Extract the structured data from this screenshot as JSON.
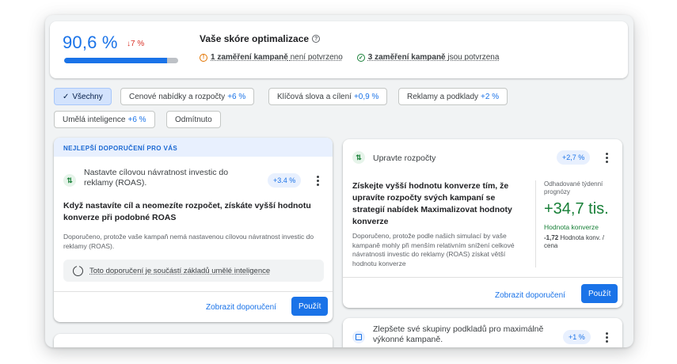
{
  "score": {
    "value": "90,6 %",
    "delta": "↓7 %",
    "progress_percent": 90.6,
    "title": "Vaše skóre optimalizace",
    "status_unconfirmed_count": "1 zaměření kampaně",
    "status_unconfirmed_suffix": "není potvrzeno",
    "status_confirmed_count": "3 zaměření kampaně",
    "status_confirmed_suffix": "jsou potvrzena"
  },
  "filters": {
    "all": "Všechny",
    "bids": "Cenové nabídky a rozpočty",
    "bids_delta": "+6 %",
    "keywords": "Klíčová slova a cílení",
    "keywords_delta": "+0,9 %",
    "ads": "Reklamy a podklady",
    "ads_delta": "+2 %",
    "ai": "Umělá inteligence",
    "ai_delta": "+6 %",
    "dismissed": "Odmítnuto"
  },
  "card_roas": {
    "header": "NEJLEPŠÍ DOPORUČENÍ PRO VÁS",
    "title": "Nastavte cílovou návratnost investic do reklamy (ROAS).",
    "badge": "+3.4 %",
    "headline": "Když nastavíte cíl a neomezíte rozpočet, získáte vyšší hodnotu konverze při podobné ROAS",
    "reason": "Doporučeno, protože vaše kampaň nemá nastavenou cílovou návratnost investic do reklamy (ROAS).",
    "ai_note": "Toto doporučení je součástí základů umělé inteligence",
    "view_label": "Zobrazit doporučení",
    "apply_label": "Použít"
  },
  "card_budget": {
    "title": "Upravte rozpočty",
    "badge": "+2,7 %",
    "headline": "Získejte vyšší hodnotu konverze tím, že upravíte rozpočty svých kampaní se strategií nabídek Maximalizovat hodnoty konverze",
    "reason": "Doporučeno, protože podle našich simulací by vaše kampaně mohly při menším relativním snížení celkové návratnosti investic do reklamy (ROAS) získat větší hodnotu konverze",
    "impact_label": "Odhadované týdenní prognózy",
    "impact_value": "+34,7 tis.",
    "impact_metric": "Hodnota konverze",
    "impact_foot_value": "-1,72",
    "impact_foot_label": "Hodnota konv. / cena",
    "view_label": "Zobrazit doporučení",
    "apply_label": "Použít"
  },
  "card_assets": {
    "title": "Zlepšete své skupiny podkladů pro maximálně výkonné kampaně.",
    "badge": "+1 %"
  },
  "colors": {
    "accent": "#1a73e8",
    "positive": "#188038",
    "negative": "#d93025",
    "warning": "#e37400"
  },
  "icons": [
    "help-icon",
    "warning-icon",
    "check-circle-icon",
    "check-icon",
    "budget-arrows-icon",
    "more-vert-icon",
    "ai-icon",
    "asset-group-icon"
  ]
}
